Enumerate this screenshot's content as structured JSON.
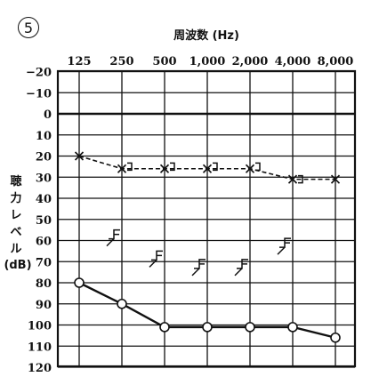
{
  "figure_number": "5",
  "chart_data": {
    "type": "line",
    "title": "",
    "xlabel": "周波数 (Hz)",
    "ylabel_lines": [
      "聴",
      "力",
      "レ",
      "ベ",
      "ル"
    ],
    "ylabel_unit": "(dB)",
    "x_categories": [
      "125",
      "250",
      "500",
      "1,000",
      "2,000",
      "4,000",
      "8,000"
    ],
    "y_ticks": [
      "−20",
      "−10",
      "0",
      "10",
      "20",
      "30",
      "40",
      "50",
      "60",
      "70",
      "80",
      "90",
      "100",
      "110",
      "120"
    ],
    "ylim": [
      -20,
      120
    ],
    "y_inverted": true,
    "grid": true,
    "series": [
      {
        "marker": "circle",
        "style": "solid",
        "points": [
          {
            "x": "125",
            "y": 80
          },
          {
            "x": "250",
            "y": 90
          },
          {
            "x": "500",
            "y": 101
          },
          {
            "x": "1,000",
            "y": 101
          },
          {
            "x": "2,000",
            "y": 101
          },
          {
            "x": "4,000",
            "y": 101
          },
          {
            "x": "8,000",
            "y": 106
          }
        ]
      },
      {
        "marker": "cross",
        "style": "dashed",
        "points": [
          {
            "x": "125",
            "y": 20
          },
          {
            "x": "250",
            "y": 26
          },
          {
            "x": "500",
            "y": 26
          },
          {
            "x": "1,000",
            "y": 26
          },
          {
            "x": "2,000",
            "y": 26
          },
          {
            "x": "4,000",
            "y": 31
          },
          {
            "x": "8,000",
            "y": 31
          }
        ]
      },
      {
        "marker": "bracket-right",
        "style": "none",
        "points": [
          {
            "x": "250",
            "y": 25
          },
          {
            "x": "500",
            "y": 25
          },
          {
            "x": "1,000",
            "y": 25
          },
          {
            "x": "2,000",
            "y": 25
          },
          {
            "x": "4,000",
            "y": 31
          }
        ]
      },
      {
        "marker": "bone-flag",
        "style": "none",
        "points": [
          {
            "x": "250",
            "y": 55
          },
          {
            "x": "500",
            "y": 65
          },
          {
            "x": "1,000",
            "y": 69
          },
          {
            "x": "2,000",
            "y": 69
          },
          {
            "x": "4,000",
            "y": 59
          }
        ]
      }
    ]
  }
}
